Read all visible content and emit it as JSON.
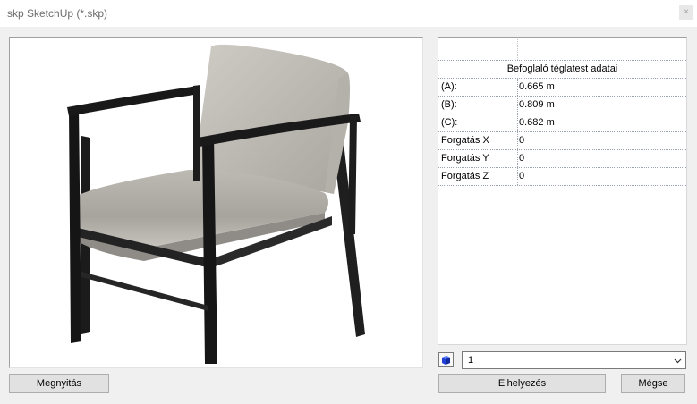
{
  "window": {
    "title": "skp SketchUp (*.skp)",
    "close_glyph": "×"
  },
  "properties": {
    "category": "Befoglaló téglatest adatai",
    "rows": [
      {
        "label": "(A):",
        "value": "0.665 m"
      },
      {
        "label": "(B):",
        "value": "0.809 m"
      },
      {
        "label": "(C):",
        "value": "0.682 m"
      },
      {
        "label": "Forgatás X",
        "value": "0"
      },
      {
        "label": "Forgatás Y",
        "value": "0"
      },
      {
        "label": "Forgatás Z",
        "value": "0"
      }
    ]
  },
  "selector": {
    "icon": "cube-icon",
    "value": "1"
  },
  "buttons": {
    "open": "Megnyitás",
    "place": "Elhelyezés",
    "cancel": "Mégse"
  },
  "preview": {
    "icon": "chair-model-preview"
  }
}
